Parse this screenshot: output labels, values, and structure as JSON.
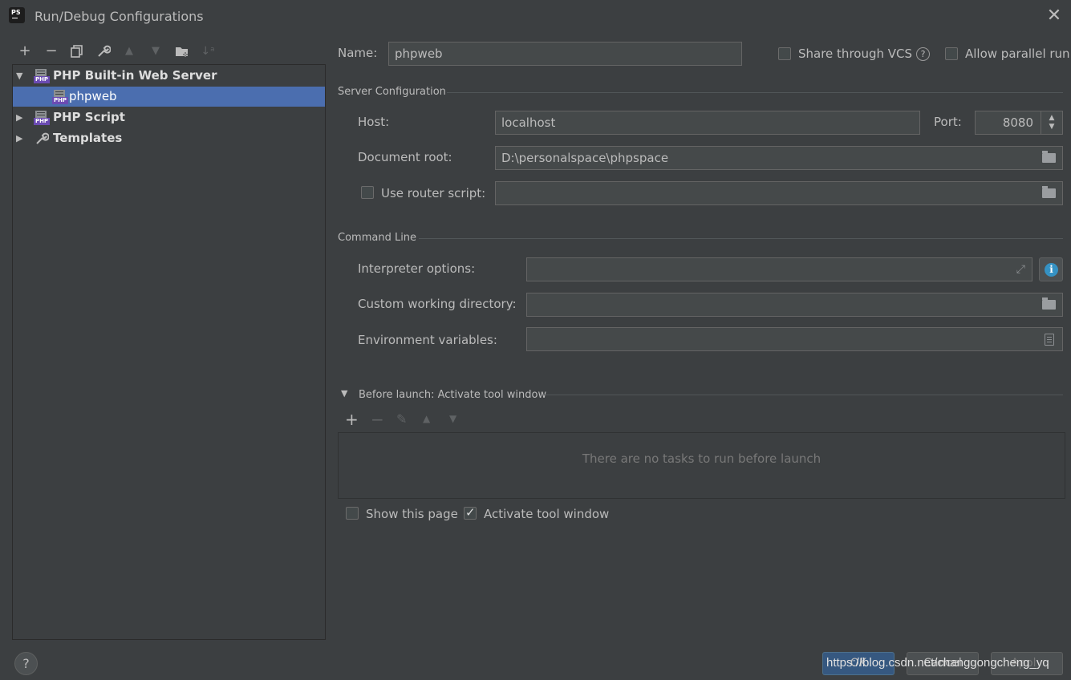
{
  "window": {
    "title": "Run/Debug Configurations"
  },
  "tree_toolbar": {
    "add": "+",
    "remove": "−",
    "copy": "⧉",
    "edit": "🔧",
    "up": "▲",
    "down": "▼",
    "folder": "📁",
    "sort": "↓"
  },
  "tree": {
    "items": [
      {
        "label": "PHP Built-in Web Server",
        "expanded": true,
        "icon": "php-server-icon"
      },
      {
        "label": "phpweb",
        "selected": true,
        "icon": "php-server-icon"
      },
      {
        "label": "PHP Script",
        "expanded": false,
        "icon": "php-server-icon"
      },
      {
        "label": "Templates",
        "expanded": false,
        "icon": "wrench-icon"
      }
    ]
  },
  "config": {
    "name_label": "Name:",
    "name_value": "phpweb",
    "share_vcs_label": "Share through VCS",
    "allow_parallel_label": "Allow parallel run",
    "server_section": "Server Configuration",
    "host_label": "Host:",
    "host_value": "localhost",
    "port_label": "Port:",
    "port_value": "8080",
    "docroot_label": "Document root:",
    "docroot_value": "D:\\personalspace\\phpspace",
    "router_label": "Use router script:",
    "router_value": "",
    "cmd_section": "Command Line",
    "interp_label": "Interpreter options:",
    "interp_value": "",
    "workdir_label": "Custom working directory:",
    "workdir_value": "",
    "env_label": "Environment variables:",
    "env_value": ""
  },
  "before_launch": {
    "title": "Before launch: Activate tool window",
    "empty_text": "There are no tasks to run before launch",
    "show_page_label": "Show this page",
    "show_page_checked": false,
    "activate_label": "Activate tool window",
    "activate_checked": true
  },
  "footer": {
    "help": "?",
    "ok_label": "OK",
    "cancel_label": "Cancel",
    "apply_label": "Apply",
    "watermark": "https://blog.csdn.net/changgongcheng_yq"
  },
  "colors": {
    "background": "#3c3f41",
    "selection": "#4b6eaf",
    "field_bg": "#45494a",
    "primary_btn": "#365880"
  }
}
